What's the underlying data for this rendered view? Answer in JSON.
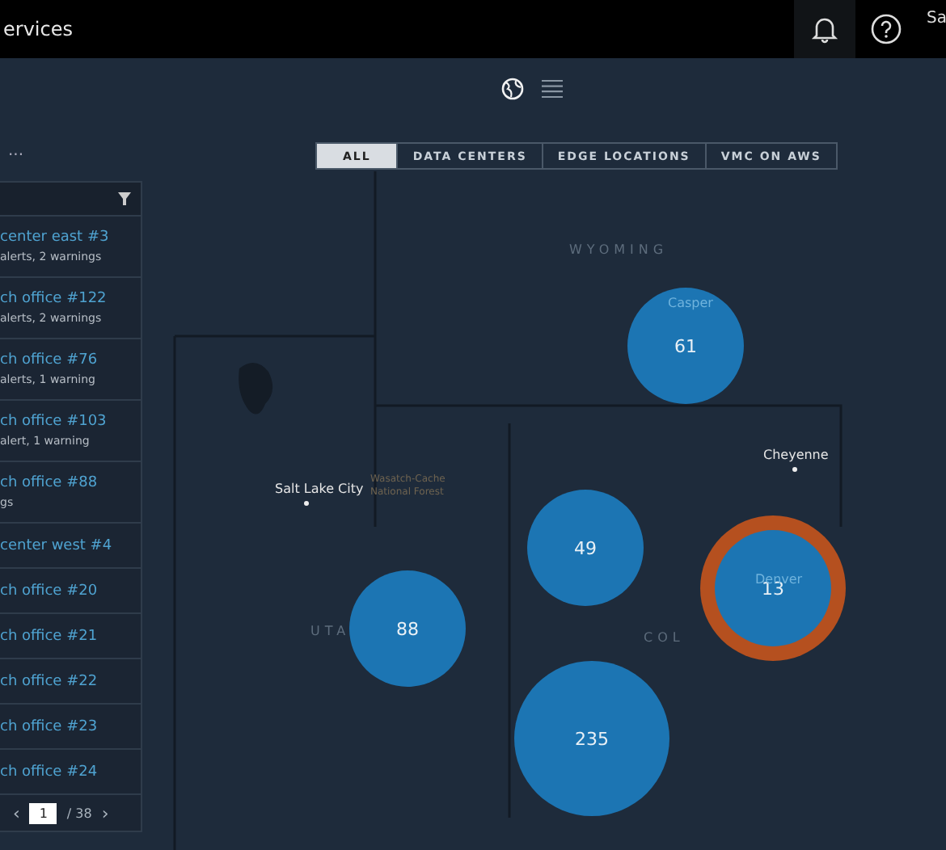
{
  "header": {
    "title": "ervices",
    "user": "Sa"
  },
  "view_toggle": [
    {
      "kind": "globe",
      "selected": true
    },
    {
      "kind": "list",
      "selected": false
    }
  ],
  "filters": [
    {
      "label": "ALL",
      "selected": true
    },
    {
      "label": "DATA CENTERS",
      "selected": false
    },
    {
      "label": "EDGE LOCATIONS",
      "selected": false
    },
    {
      "label": "VMC ON AWS",
      "selected": false
    }
  ],
  "sidebar": {
    "more": "...",
    "items": [
      {
        "title": "center east #3",
        "subtitle": "alerts, 2 warnings"
      },
      {
        "title": "ch office #122",
        "subtitle": "alerts, 2 warnings"
      },
      {
        "title": "ch office #76",
        "subtitle": "alerts, 1 warning"
      },
      {
        "title": "ch office #103",
        "subtitle": "alert, 1 warning"
      },
      {
        "title": "ch office #88",
        "subtitle": "gs"
      },
      {
        "title": "center west #4"
      },
      {
        "title": "ch office #20"
      },
      {
        "title": "ch office #21"
      },
      {
        "title": "ch office #22"
      },
      {
        "title": "ch office #23"
      },
      {
        "title": "ch office #24"
      }
    ],
    "pagination": {
      "prev": "‹",
      "page": "1",
      "total": "/ 38",
      "next": "›"
    }
  },
  "map": {
    "labels": [
      {
        "kind": "state",
        "text": "WYOMING"
      },
      {
        "kind": "city",
        "text": "Cheyenne"
      },
      {
        "kind": "city",
        "text": "Salt Lake City"
      },
      {
        "kind": "forest",
        "text": "Wasatch-Cache"
      },
      {
        "kind": "forest",
        "text": "National Forest"
      },
      {
        "kind": "state",
        "text": "UTA"
      },
      {
        "kind": "state",
        "text": "COL"
      },
      {
        "kind": "faint",
        "text": "Casper"
      },
      {
        "kind": "faint",
        "text": "Denver"
      }
    ],
    "clusters": [
      {
        "count": "61",
        "selected": false
      },
      {
        "count": "49",
        "selected": false
      },
      {
        "count": "88",
        "selected": false
      },
      {
        "count": "235",
        "selected": false
      },
      {
        "count": "13",
        "selected": true
      }
    ]
  }
}
